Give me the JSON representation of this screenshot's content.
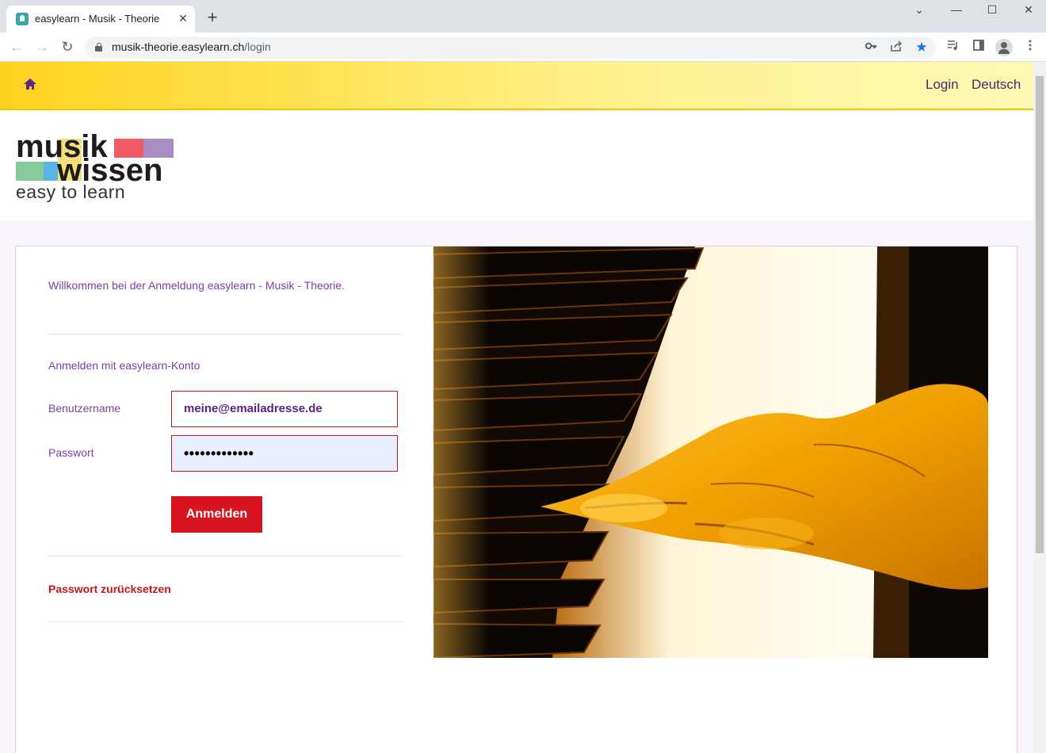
{
  "browser": {
    "tab_title": "easylearn - Musik - Theorie",
    "tab_close": "✕",
    "new_tab": "+",
    "url_host": "musik-theorie.easylearn.ch",
    "url_path": "/login",
    "window_controls": {
      "minimize": "—",
      "maximize": "☐",
      "close": "✕",
      "tab_list": "⌄"
    },
    "nav": {
      "back": "←",
      "forward": "→",
      "reload": "↻"
    },
    "omnibox_icons": [
      "key-icon",
      "share-icon",
      "star-icon"
    ],
    "toolbar_icons": [
      "media-icon",
      "side-panel-icon",
      "profile-icon",
      "menu-icon"
    ]
  },
  "header": {
    "home_icon": "home-icon",
    "nav_links": [
      "Login",
      "Deutsch"
    ]
  },
  "logo": {
    "word_top": "musik",
    "word_bottom": "wissen",
    "tagline": "easy to learn",
    "colors": {
      "red": "#ef5a65",
      "purple": "#a98cc4",
      "green": "#86c99a",
      "blue": "#5ab4e6",
      "yellow": "#f7dd77"
    }
  },
  "login": {
    "welcome": "Willkommen bei der Anmeldung easylearn - Musik - Theorie.",
    "section_title": "Anmelden mit easylearn-Konto",
    "username_label": "Benutzername",
    "username_value": "meine@emailadresse.de",
    "password_label": "Passwort",
    "password_value": "•••••••••••••",
    "submit_label": "Anmelden",
    "reset_link": "Passwort zurücksetzen"
  },
  "colors": {
    "accent_purple": "#7b3fa0",
    "accent_red": "#d7141f",
    "header_yellow": "#ffd21f"
  }
}
